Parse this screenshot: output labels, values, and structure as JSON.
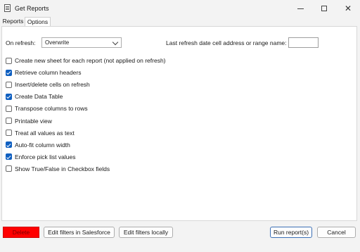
{
  "window": {
    "title": "Get Reports",
    "icon": "report-document-icon"
  },
  "tabs": [
    {
      "label": "Reports",
      "selected": false
    },
    {
      "label": "Options",
      "selected": true
    }
  ],
  "options": {
    "on_refresh_label": "On refresh:",
    "on_refresh_value": "Overwrite",
    "last_refresh_label": "Last refresh date cell address or range name:",
    "last_refresh_value": "",
    "checkboxes": [
      {
        "label": "Create new sheet for each report (not applied on refresh)",
        "checked": false
      },
      {
        "label": "Retrieve column headers",
        "checked": true
      },
      {
        "label": "Insert/delete cells on refresh",
        "checked": false
      },
      {
        "label": "Create Data Table",
        "checked": true
      },
      {
        "label": "Transpose columns to rows",
        "checked": false
      },
      {
        "label": "Printable view",
        "checked": false
      },
      {
        "label": "Treat all values as text",
        "checked": false
      },
      {
        "label": "Auto-fit column width",
        "checked": true
      },
      {
        "label": "Enforce pick list values",
        "checked": true
      },
      {
        "label": "Show True/False in Checkbox fields",
        "checked": false
      }
    ]
  },
  "buttons": {
    "delete": "Delete",
    "edit_filters_sf": "Edit filters in Salesforce",
    "edit_filters_local": "Edit filters locally",
    "run": "Run report(s)",
    "cancel": "Cancel"
  },
  "colors": {
    "delete_button": "#ff0000",
    "checkbox_checked": "#0f5fc0"
  }
}
